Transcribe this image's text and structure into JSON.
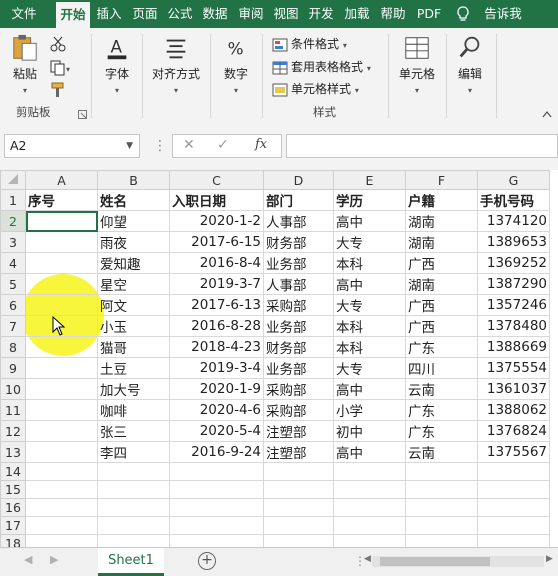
{
  "tabs": [
    "文件",
    "开始",
    "插入",
    "页面",
    "公式",
    "数据",
    "审阅",
    "视图",
    "开发",
    "加载",
    "帮助",
    "PDF",
    "告诉我"
  ],
  "ribbon": {
    "clipboard": {
      "paste": "粘贴",
      "group": "剪贴板"
    },
    "font": "字体",
    "align": "对齐方式",
    "number": "数字",
    "styles": {
      "cond": "条件格式",
      "table": "套用表格格式",
      "cell": "单元格样式",
      "group": "样式"
    },
    "cells": "单元格",
    "edit": "编辑"
  },
  "formula_bar": {
    "name_box": "A2",
    "fx": "fx",
    "cancel": "✕",
    "enter": "✓",
    "formula": ""
  },
  "columns": [
    "A",
    "B",
    "C",
    "D",
    "E",
    "F",
    "G"
  ],
  "rows": [
    [
      "序号",
      "姓名",
      "入职日期",
      "部门",
      "学历",
      "户籍",
      "手机号码"
    ],
    [
      "",
      "仰望",
      "2020-1-2",
      "人事部",
      "高中",
      "湖南",
      "1374120"
    ],
    [
      "",
      "雨夜",
      "2017-6-15",
      "财务部",
      "大专",
      "湖南",
      "1389653"
    ],
    [
      "",
      "爱知趣",
      "2016-8-4",
      "业务部",
      "本科",
      "广西",
      "1369252"
    ],
    [
      "",
      "星空",
      "2019-3-7",
      "人事部",
      "高中",
      "湖南",
      "1387290"
    ],
    [
      "",
      "阿文",
      "2017-6-13",
      "采购部",
      "大专",
      "广西",
      "1357246"
    ],
    [
      "",
      "小玉",
      "2016-8-28",
      "业务部",
      "本科",
      "广西",
      "1378480"
    ],
    [
      "",
      "猫哥",
      "2018-4-23",
      "财务部",
      "本科",
      "广东",
      "1388669"
    ],
    [
      "",
      "土豆",
      "2019-3-4",
      "业务部",
      "大专",
      "四川",
      "1375554"
    ],
    [
      "",
      "加大号",
      "2020-1-9",
      "采购部",
      "高中",
      "云南",
      "1361037"
    ],
    [
      "",
      "咖啡",
      "2020-4-6",
      "采购部",
      "小学",
      "广东",
      "1388062"
    ],
    [
      "",
      "张三",
      "2020-5-4",
      "注塑部",
      "初中",
      "广东",
      "1376824"
    ],
    [
      "",
      "李四",
      "2016-9-24",
      "注塑部",
      "高中",
      "云南",
      "1375567"
    ],
    [
      "",
      "",
      "",
      "",
      "",
      "",
      ""
    ],
    [
      "",
      "",
      "",
      "",
      "",
      "",
      ""
    ],
    [
      "",
      "",
      "",
      "",
      "",
      "",
      ""
    ],
    [
      "",
      "",
      "",
      "",
      "",
      "",
      ""
    ],
    [
      "",
      "",
      "",
      "",
      "",
      "",
      ""
    ],
    [
      "",
      "",
      "",
      "",
      "",
      "",
      ""
    ]
  ],
  "sheet_tab": "Sheet1",
  "add_sheet": "+",
  "colors": {
    "accent": "#217346",
    "highlight": "#f6f31a"
  }
}
